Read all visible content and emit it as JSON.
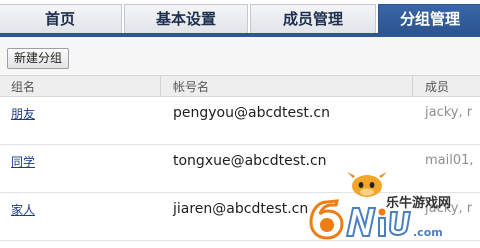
{
  "tabs": [
    {
      "label": "首页",
      "active": false
    },
    {
      "label": "基本设置",
      "active": false
    },
    {
      "label": "成员管理",
      "active": false
    },
    {
      "label": "分组管理",
      "active": true
    }
  ],
  "toolbar": {
    "new_group_label": "新建分组"
  },
  "table": {
    "headers": {
      "name": "组名",
      "account": "帐号名",
      "members": "成员"
    },
    "rows": [
      {
        "name": "朋友",
        "account": "pengyou@abcdtest.cn",
        "members": "jacky, r"
      },
      {
        "name": "同学",
        "account": "tongxue@abcdtest.cn",
        "members": "mail01,"
      },
      {
        "name": "家人",
        "account": "jiaren@abcdtest.cn",
        "members": "jacky, r"
      }
    ]
  },
  "watermark": {
    "brand_text": "乐牛游戏网",
    "logo_text": "6NiU.com"
  },
  "colors": {
    "accent": "#2d5794",
    "link": "#1a3c8c",
    "muted": "#8f8f8f"
  }
}
